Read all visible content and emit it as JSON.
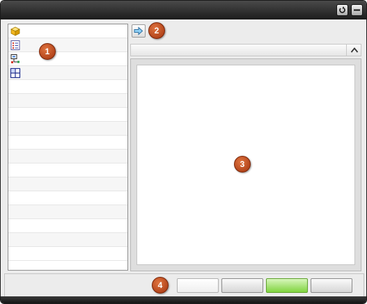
{
  "titlebar": {
    "buttons": [
      {
        "icon": "restore-icon"
      },
      {
        "icon": "minimize-icon"
      }
    ]
  },
  "sidebar": {
    "items": [
      {
        "icon": "cube-icon",
        "label": ""
      },
      {
        "icon": "checklist-icon",
        "label": ""
      },
      {
        "icon": "hierarchy-icon",
        "label": ""
      },
      {
        "icon": "table-grid-icon",
        "label": ""
      }
    ],
    "empty_rows": 13
  },
  "toolbar": {
    "forward_icon": "arrow-right-icon"
  },
  "panel_header": {
    "collapse_icon": "chevron-up-icon"
  },
  "footer": {
    "buttons": [
      {
        "label": ""
      },
      {
        "label": ""
      },
      {
        "label": ""
      },
      {
        "label": ""
      }
    ]
  },
  "callouts": [
    "1",
    "2",
    "3",
    "4"
  ],
  "colors": {
    "titlebar": "#1c1c1c",
    "callout": "#b84318",
    "primary_button": "#80d33f"
  }
}
